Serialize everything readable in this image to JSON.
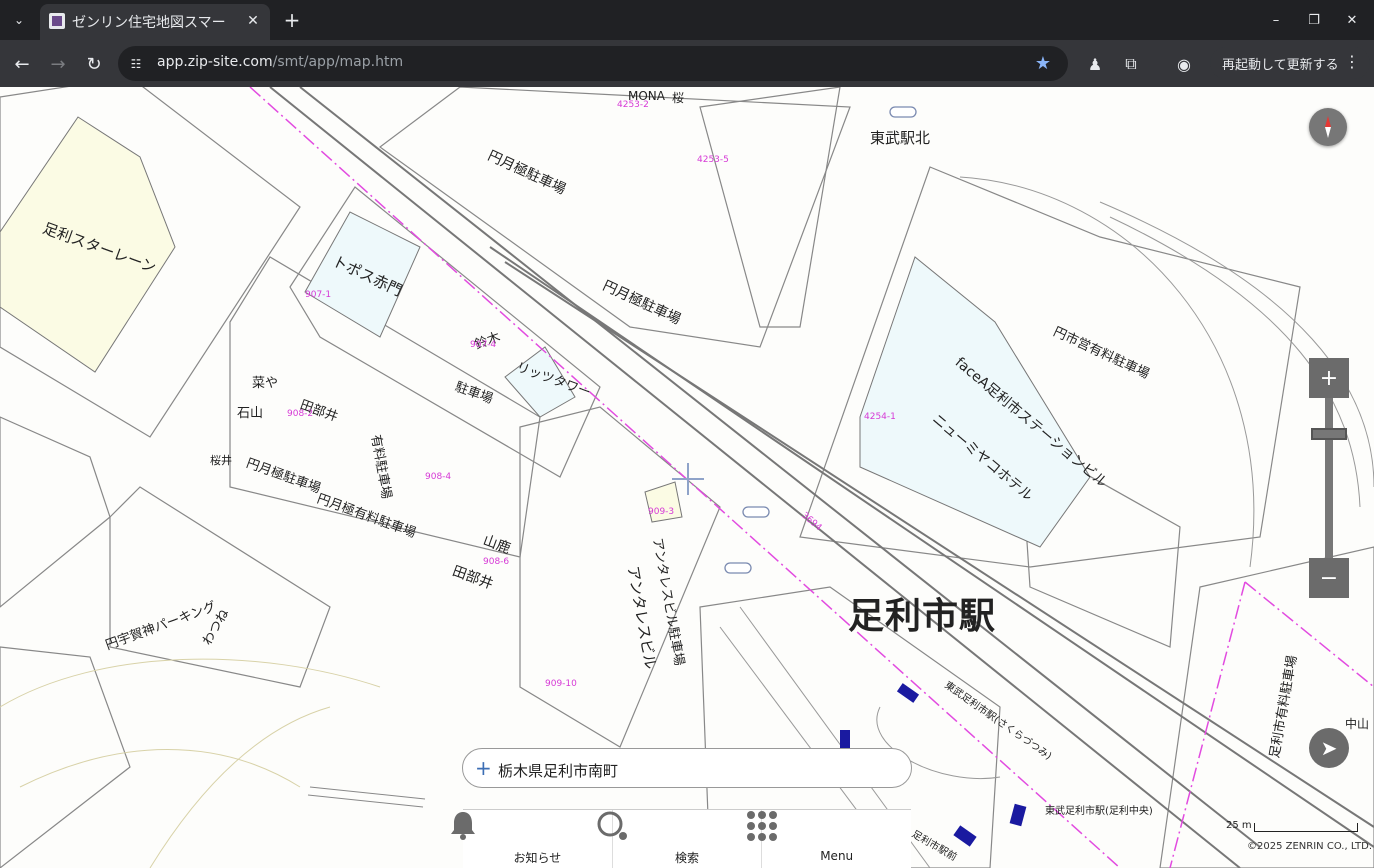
{
  "browser": {
    "tab_title": "ゼンリン住宅地図スマー",
    "tab_close": "✕",
    "new_tab": "+",
    "url_host": "app.zip-site.com",
    "url_path": "/smt/app/map.htm",
    "restart_label": "再起動して更新する",
    "menu_dots": "⋮",
    "window_minimize": "–",
    "window_restore": "❐",
    "window_close": "✕"
  },
  "map": {
    "station_name": "足利市駅",
    "station_north": "東武駅北",
    "labels": [
      "足利スターレーン",
      "トポス赤門",
      "円月極駐車場",
      "円月極駐車場",
      "faceA足利市ステーションビル",
      "ニューミヤコホテル",
      "円市営有料駐車場",
      "アンタレスビル駐車場",
      "アンタレスビル",
      "山鹿",
      "田部井",
      "田部井",
      "鈴木",
      "リッツタワー",
      "駐車場",
      "有料駐車場",
      "石山",
      "菜や",
      "桜井",
      "円月極駐車場",
      "円月極有料駐車場",
      "円宇賀神パーキング",
      "わつね",
      "足利市有料駐車場",
      "MONA",
      "桜",
      "東武足利市駅(足利中央)",
      "東武足利市駅(さくらづつみ)",
      "中山",
      "足利市駅前"
    ],
    "parcels": [
      "4253-2",
      "4253-5",
      "907-1",
      "907-4",
      "908-2",
      "908-4",
      "908-6",
      "909-3",
      "909-10",
      "4254-1",
      "3694"
    ],
    "address": "栃木県足利市南町",
    "address_plus": "+",
    "zoom_in": "+",
    "zoom_out": "−",
    "scale_label": "25 m",
    "copyright": "©2025 ZENRIN CO., LTD."
  },
  "bottom_nav": {
    "items": [
      {
        "label": "お知らせ",
        "icon": "bell-icon"
      },
      {
        "label": "検索",
        "icon": "search-icon"
      },
      {
        "label": "Menu",
        "icon": "grid-icon"
      }
    ]
  }
}
